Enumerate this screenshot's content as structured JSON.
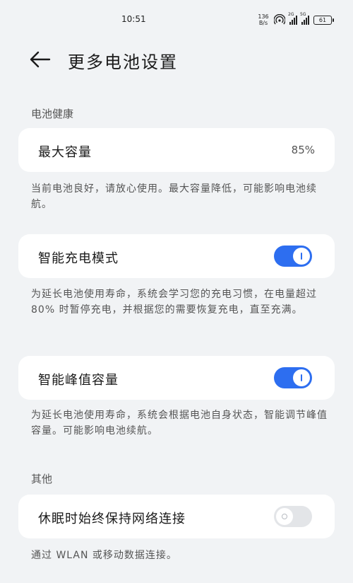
{
  "status_bar": {
    "time": "10:51",
    "net_speed_value": "136",
    "net_speed_unit": "B/s",
    "signal1_label": "2G",
    "signal2_label": "5G",
    "battery_level": "61",
    "icons": [
      "hotspot-icon",
      "signal-icon",
      "signal-icon",
      "battery-icon"
    ]
  },
  "header": {
    "title": "更多电池设置"
  },
  "sections": {
    "battery_health_label": "电池健康",
    "other_label": "其他"
  },
  "max_capacity": {
    "title": "最大容量",
    "value": "85%",
    "description": "当前电池良好，请放心使用。最大容量降低，可能影响电池续航。"
  },
  "smart_charging": {
    "title": "智能充电模式",
    "enabled": true,
    "description": "为延长电池使用寿命，系统会学习您的充电习惯，在电量超过 80% 时暂停充电，并根据您的需要恢复充电，直至充满。"
  },
  "smart_peak_capacity": {
    "title": "智能峰值容量",
    "enabled": true,
    "description": "为延长电池使用寿命，系统会根据电池自身状态，智能调节峰值容量。可能影响电池续航。"
  },
  "sleep_network": {
    "title": "休眠时始终保持网络连接",
    "enabled": false,
    "description": "通过 WLAN 或移动数据连接。"
  },
  "colors": {
    "accent": "#2d6ef0",
    "background": "#f1f3f5",
    "card": "#ffffff"
  }
}
